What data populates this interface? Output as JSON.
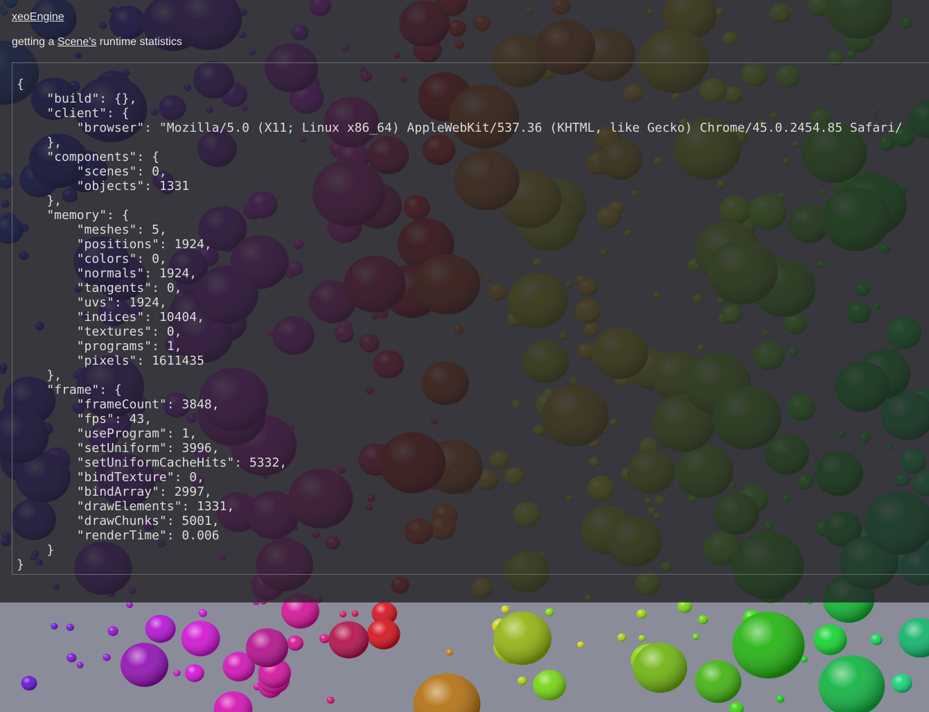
{
  "header": {
    "title_link": "xeoEngine",
    "subtitle_prefix": "getting a ",
    "subtitle_link": "Scene's",
    "subtitle_suffix": " runtime statistics"
  },
  "stats": {
    "build": "{}",
    "client": {
      "browser": "Mozilla/5.0 (X11; Linux x86_64) AppleWebKit/537.36 (KHTML, like Gecko) Chrome/45.0.2454.85 Safari/"
    },
    "components": {
      "scenes": "0",
      "objects": "1331"
    },
    "memory": {
      "meshes": "5",
      "positions": "1924",
      "colors": "0",
      "normals": "1924",
      "tangents": "0",
      "uvs": "1924",
      "indices": "10404",
      "textures": "0",
      "programs": "1",
      "pixels": "1611435"
    },
    "frame": {
      "frameCount": "3848",
      "fps": "43",
      "useProgram": "1",
      "setUniform": "3996",
      "setUniformCacheHits": "5332",
      "bindTexture": "0",
      "bindArray": "2997",
      "drawElements": "1331",
      "drawChunks": "5001",
      "renderTime": "0.006"
    }
  },
  "colors": {
    "overlay": "#222226",
    "floor": "#8a8c9a",
    "text": "#dcdcdc"
  }
}
